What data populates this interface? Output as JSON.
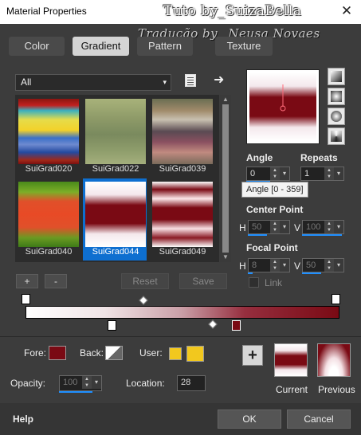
{
  "window": {
    "title": "Material Properties",
    "close_symbol": "✕"
  },
  "watermark": {
    "line1": "Tuto by_SuizaBella",
    "line2": "Tradução by_ Neusa Novaes"
  },
  "tabs": [
    {
      "label": "Color"
    },
    {
      "label": "Gradient",
      "active": true
    },
    {
      "label": "Pattern"
    },
    {
      "label": "Texture"
    }
  ],
  "library": {
    "category": "All",
    "dropdown_arrow": "▾",
    "next_arrow": "➜"
  },
  "gradients": [
    {
      "name": "SuiGrad020"
    },
    {
      "name": "SuiGrad022"
    },
    {
      "name": "SuiGrad039"
    },
    {
      "name": "SuiGrad040"
    },
    {
      "name": "SuiGrad044",
      "selected": true
    },
    {
      "name": "SuiGrad049"
    }
  ],
  "gallery_buttons": {
    "add": "+",
    "remove": "-",
    "reset": "Reset",
    "save": "Save"
  },
  "style": {
    "angle_label": "Angle",
    "angle_value": "0",
    "repeats_label": "Repeats",
    "repeats_value": "1",
    "tooltip": "Angle [0 - 359]",
    "center_point_label": "Center Point",
    "center_h_label": "H",
    "center_h_value": "50",
    "center_v_label": "V",
    "center_v_value": "100",
    "focal_point_label": "Focal Point",
    "focal_h_label": "H",
    "focal_h_value": "8",
    "focal_v_label": "V",
    "focal_v_value": "50",
    "link_label": "Link"
  },
  "material": {
    "fore_label": "Fore:",
    "back_label": "Back:",
    "user_label": "User:",
    "opacity_label": "Opacity:",
    "opacity_value": "100",
    "location_label": "Location:",
    "location_value": "28",
    "current_label": "Current",
    "previous_label": "Previous",
    "add_symbol": "+"
  },
  "colors": {
    "dark_red": "#7a0a14",
    "white": "#ffffff",
    "user_yellow": "#f2c81e",
    "selection_blue": "#0e6fd0",
    "accent_bar_blue": "#1e8fff"
  },
  "footer": {
    "help": "Help",
    "ok": "OK",
    "cancel": "Cancel"
  }
}
